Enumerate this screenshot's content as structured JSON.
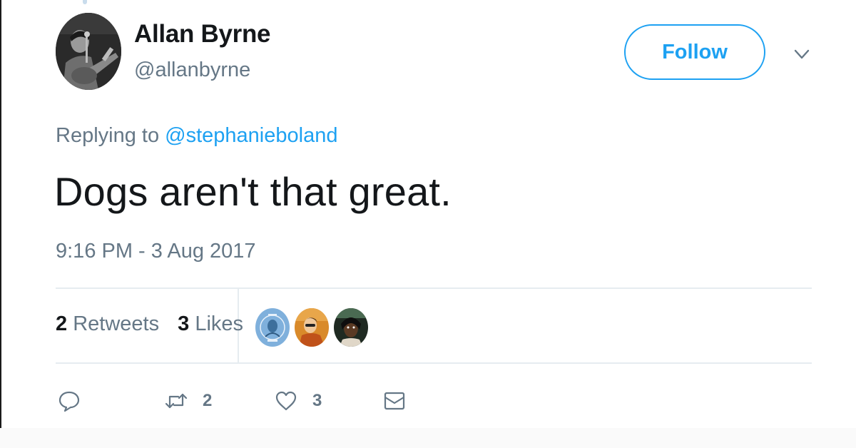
{
  "author": {
    "display_name": "Allan Byrne",
    "handle": "@allanbyrne",
    "avatar_icon": "profile-photo"
  },
  "follow_button": {
    "label": "Follow",
    "color": "#1da1f2"
  },
  "menu_icon": "chevron-down-icon",
  "reply_context": {
    "prefix": "Replying to",
    "mention": "@stephanieboland"
  },
  "tweet": {
    "text": "Dogs aren't that great.",
    "timestamp": "9:16 PM - 3 Aug 2017"
  },
  "stats": {
    "retweets_count": "2",
    "retweets_label": "Retweets",
    "likes_count": "3",
    "likes_label": "Likes",
    "likers": [
      "liker-avatar-1",
      "liker-avatar-2",
      "liker-avatar-3"
    ]
  },
  "actions": {
    "reply_icon": "reply-icon",
    "retweet_icon": "retweet-icon",
    "retweet_count": "2",
    "like_icon": "heart-icon",
    "like_count": "3",
    "dm_icon": "envelope-icon"
  },
  "colors": {
    "text": "#14171a",
    "secondary": "#657786",
    "accent": "#1da1f2",
    "divider": "#e6ecf0"
  }
}
